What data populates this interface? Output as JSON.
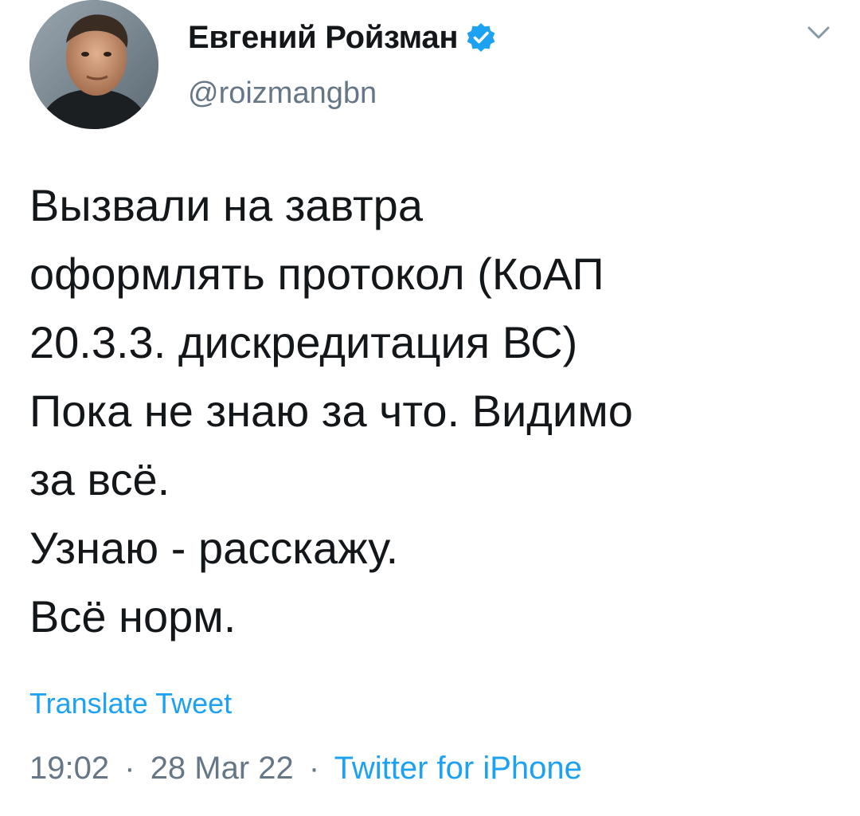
{
  "author": {
    "display_name": "Евгений Ройзман",
    "handle": "@roizmangbn",
    "verified": true
  },
  "tweet": {
    "lines": [
      "Вызвали на завтра",
      "оформлять протокол (КоАП",
      "20.3.3. дискредитация ВС)",
      "Пока не знаю за что. Видимо",
      "за всё.",
      "Узнаю - расскажу.",
      "Всё норм."
    ]
  },
  "translate_label": "Translate Tweet",
  "meta": {
    "time": "19:02",
    "date": "28 Mar 22",
    "separator": "·",
    "source": "Twitter for iPhone"
  },
  "colors": {
    "link": "#1da1f2",
    "secondary_text": "#657786",
    "primary_text": "#14171a"
  },
  "icons": {
    "verified": "verified-badge-icon",
    "menu": "chevron-down-icon"
  }
}
